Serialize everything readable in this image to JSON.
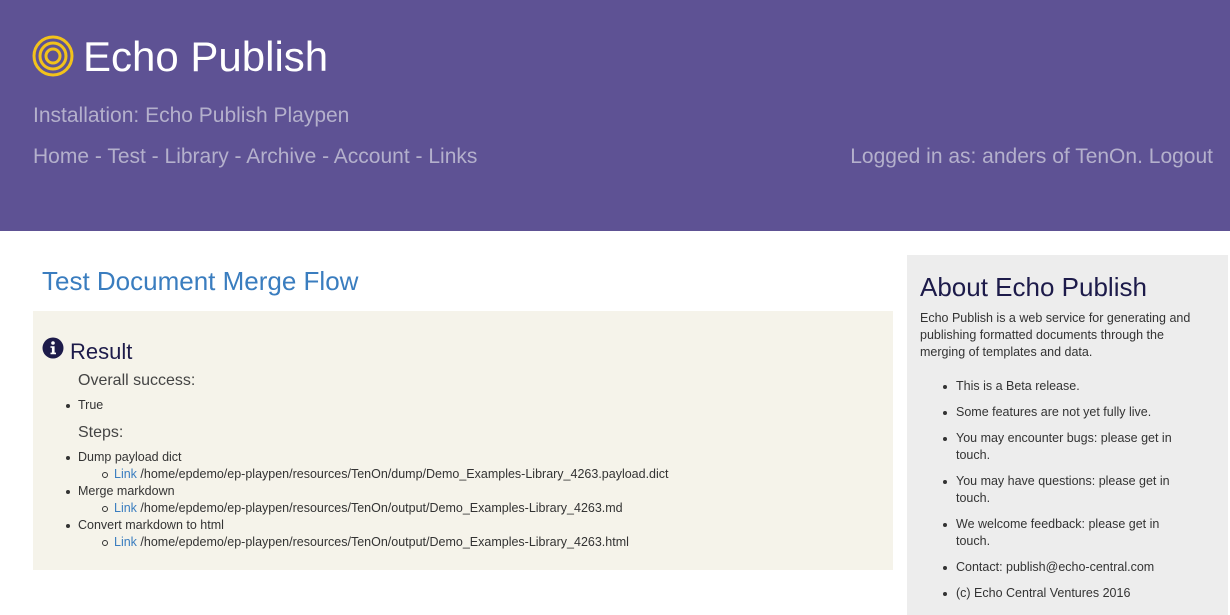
{
  "header": {
    "brand": "Echo Publish",
    "logo_icon": "concentric-rings-icon",
    "installation": "Installation: Echo Publish Playpen",
    "nav": [
      "Home",
      "Test",
      "Library",
      "Archive",
      "Account",
      "Links"
    ],
    "nav_separator": " - ",
    "login_prefix": "Logged in as: anders of TenOn.",
    "logout": "Logout",
    "colors": {
      "background": "#5e5294",
      "brand": "#ffffff",
      "muted": "#b4b0cc",
      "logo": "#f2c21b"
    }
  },
  "main": {
    "title": "Test Document Merge Flow",
    "result": {
      "icon": "info-circle-icon",
      "heading": "Result",
      "overall_label": "Overall success:",
      "overall_value": "True",
      "steps_label": "Steps:",
      "steps": [
        {
          "name": "Dump payload dict",
          "link_label": "Link",
          "path": "/home/epdemo/ep-playpen/resources/TenOn/dump/Demo_Examples-Library_4263.payload.dict"
        },
        {
          "name": "Merge markdown",
          "link_label": "Link",
          "path": "/home/epdemo/ep-playpen/resources/TenOn/output/Demo_Examples-Library_4263.md"
        },
        {
          "name": "Convert markdown to html",
          "link_label": "Link",
          "path": "/home/epdemo/ep-playpen/resources/TenOn/output/Demo_Examples-Library_4263.html"
        }
      ]
    },
    "colors": {
      "title": "#3a7dbf",
      "panel": "#f5f3ea",
      "link": "#3a7dbf"
    }
  },
  "sidebar": {
    "title": "About Echo Publish",
    "description": "Echo Publish is a web service for generating and publishing formatted documents through the merging of templates and data.",
    "items": [
      "This is a Beta release.",
      "Some features are not yet fully live.",
      "You may encounter bugs: please get in touch.",
      "You may have questions: please get in touch.",
      "We welcome feedback: please get in touch.",
      "Contact: publish@echo-central.com",
      "(c) Echo Central Ventures 2016"
    ],
    "colors": {
      "background": "#ededed",
      "title": "#1d1b4a"
    }
  }
}
